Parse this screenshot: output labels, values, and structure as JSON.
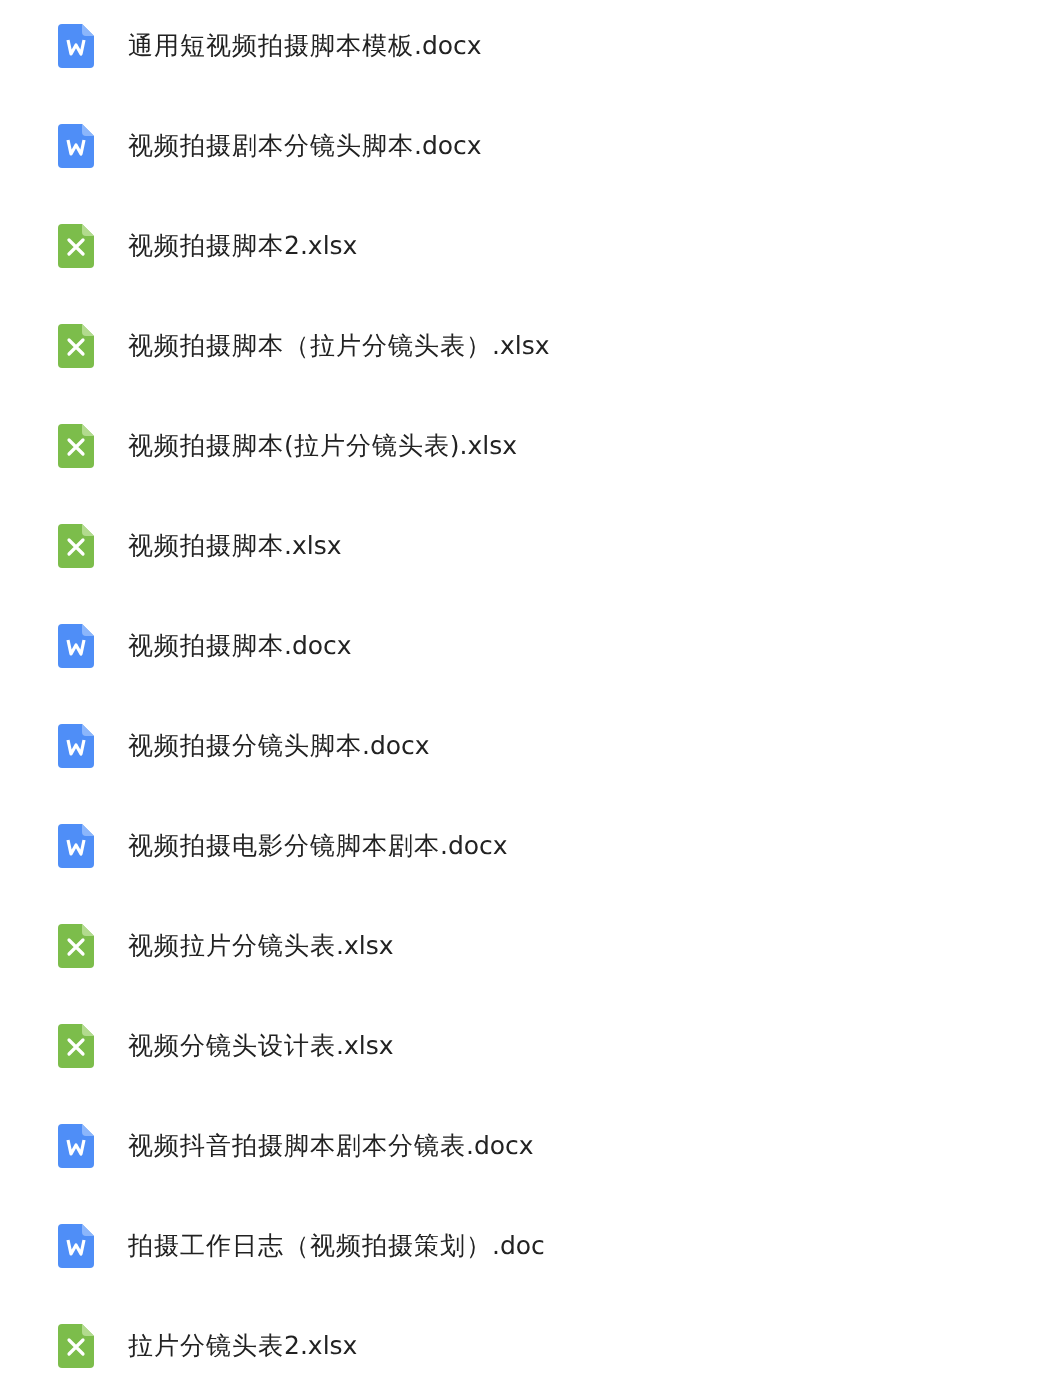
{
  "files": [
    {
      "name": "通用短视频拍摄脚本模板.docx",
      "kind": "word"
    },
    {
      "name": "视频拍摄剧本分镜头脚本.docx",
      "kind": "word"
    },
    {
      "name": "视频拍摄脚本2.xlsx",
      "kind": "excel"
    },
    {
      "name": "视频拍摄脚本（拉片分镜头表）.xlsx",
      "kind": "excel"
    },
    {
      "name": "视频拍摄脚本(拉片分镜头表).xlsx",
      "kind": "excel"
    },
    {
      "name": "视频拍摄脚本.xlsx",
      "kind": "excel"
    },
    {
      "name": "视频拍摄脚本.docx",
      "kind": "word"
    },
    {
      "name": "视频拍摄分镜头脚本.docx",
      "kind": "word"
    },
    {
      "name": "视频拍摄电影分镜脚本剧本.docx",
      "kind": "word"
    },
    {
      "name": "视频拉片分镜头表.xlsx",
      "kind": "excel"
    },
    {
      "name": "视频分镜头设计表.xlsx",
      "kind": "excel"
    },
    {
      "name": "视频抖音拍摄脚本剧本分镜表.docx",
      "kind": "word"
    },
    {
      "name": "拍摄工作日志（视频拍摄策划）.doc",
      "kind": "word"
    },
    {
      "name": "拉片分镜头表2.xlsx",
      "kind": "excel"
    }
  ]
}
